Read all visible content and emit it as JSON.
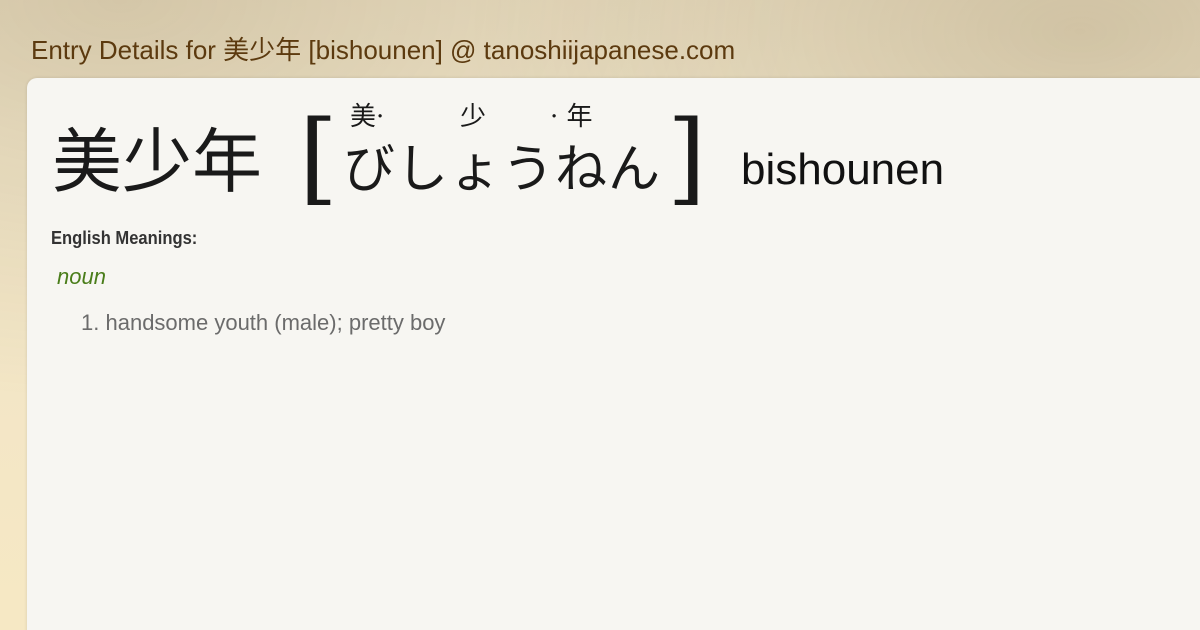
{
  "header": {
    "title": "Entry Details for 美少年 [bishounen] @ tanoshiijapanese.com"
  },
  "entry": {
    "kanji": "美少年",
    "bracket_open": "[",
    "bracket_close": "]",
    "furigana": [
      "美·",
      "少",
      "· 年"
    ],
    "kana": "びしょうねん",
    "romaji": "bishounen"
  },
  "meanings": {
    "label": "English Meanings:",
    "part_of_speech": "noun",
    "items": [
      {
        "number": "1.",
        "text": "handsome youth (male); pretty boy"
      }
    ]
  },
  "colors": {
    "header_text": "#5c3a0f",
    "pos_text": "#4a7d1a",
    "meaning_text": "#6b6b6b",
    "card_bg": "#f7f6f2"
  }
}
